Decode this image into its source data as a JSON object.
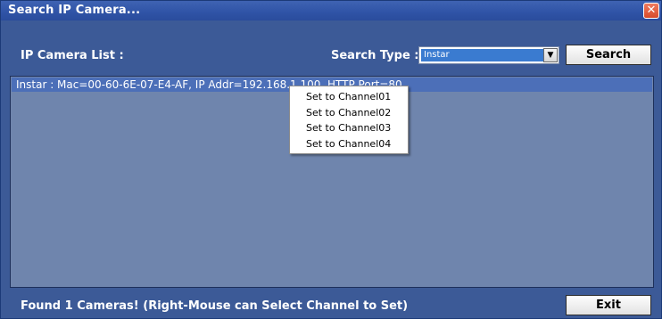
{
  "window": {
    "title": "Search IP Camera..."
  },
  "header": {
    "list_label": "IP Camera List :",
    "search_type_label": "Search Type :",
    "search_type_value": "Instar",
    "search_button": "Search"
  },
  "camera_list": {
    "items": [
      {
        "text": "Instar : Mac=00-60-6E-07-E4-AF,  IP Addr=192.168.1.100,  HTTP Port=80"
      }
    ]
  },
  "context_menu": {
    "items": [
      {
        "label": "Set to Channel01"
      },
      {
        "label": "Set to Channel02"
      },
      {
        "label": "Set to Channel03"
      },
      {
        "label": "Set to Channel04"
      }
    ]
  },
  "footer": {
    "status": "Found 1 Cameras! (Right-Mouse can Select Channel to Set)",
    "exit_button": "Exit"
  },
  "colors": {
    "window_bg": "#3c5a97",
    "list_bg": "#6f85ad",
    "selected_row": "#4c6fb8",
    "close_button": "#d84a2a"
  },
  "icons": [
    "close-icon",
    "dropdown-arrow-icon"
  ]
}
